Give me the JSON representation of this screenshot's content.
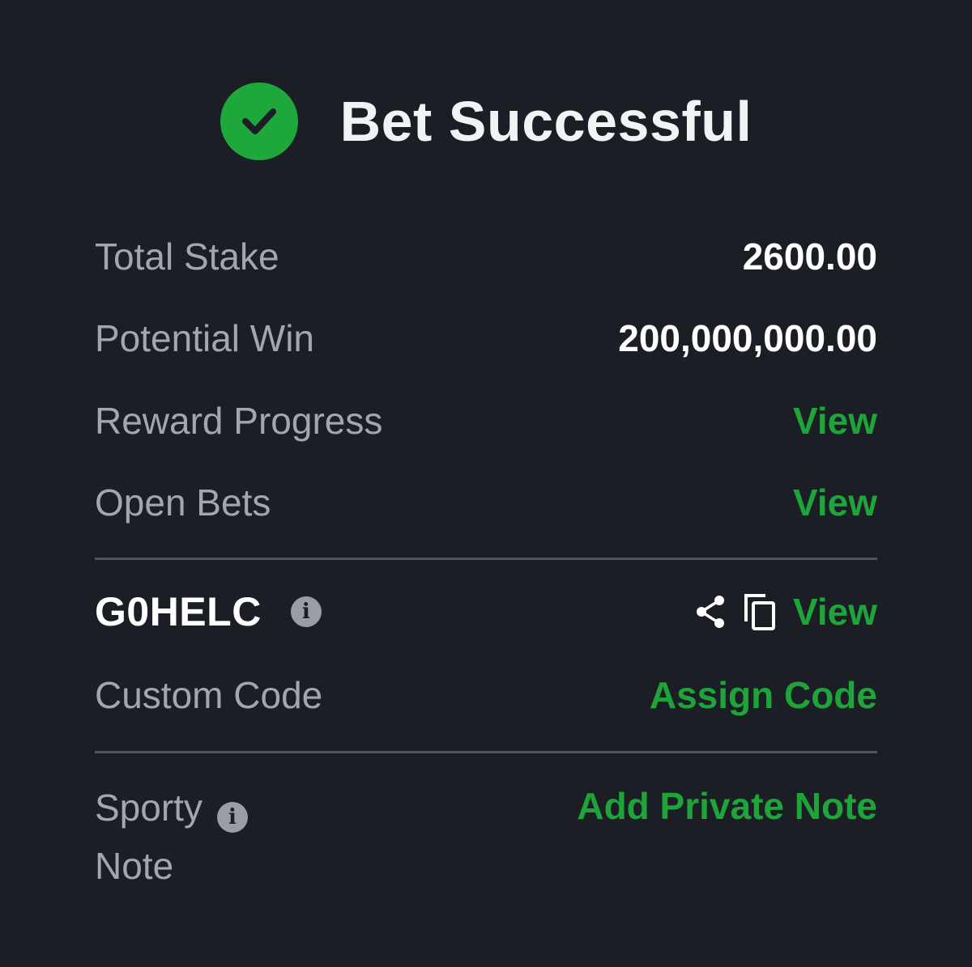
{
  "header": {
    "title": "Bet Successful",
    "icon": "check-circle-icon",
    "accent_color": "#1ea83c"
  },
  "summary": {
    "total_stake_label": "Total Stake",
    "total_stake_value": "2600.00",
    "potential_win_label": "Potential Win",
    "potential_win_value": "200,000,000.00",
    "reward_progress_label": "Reward Progress",
    "reward_progress_link": "View",
    "open_bets_label": "Open Bets",
    "open_bets_link": "View"
  },
  "booking": {
    "code": "G0HELC",
    "view_link": "View",
    "custom_code_label": "Custom Code",
    "assign_code_link": "Assign Code"
  },
  "note": {
    "label_line1": "Sporty",
    "label_line2": "Note",
    "add_note_link": "Add Private Note"
  },
  "colors": {
    "background": "#1b1e25",
    "link": "#1fa43a",
    "label": "#a3a6b0",
    "value": "#ffffff"
  }
}
